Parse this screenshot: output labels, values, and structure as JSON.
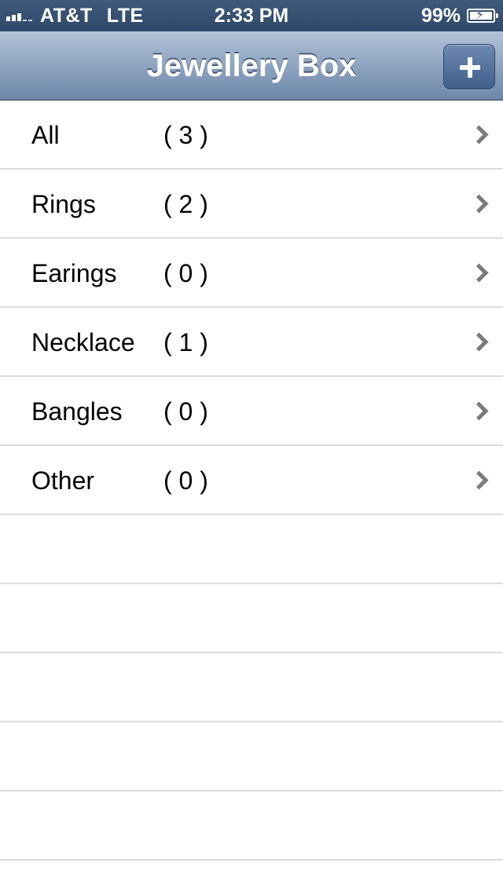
{
  "status_bar": {
    "carrier": "AT&T",
    "network": "LTE",
    "time": "2:33 PM",
    "battery_percent": "99%"
  },
  "nav": {
    "title": "Jewellery Box",
    "add_button_icon": "plus-icon"
  },
  "categories": [
    {
      "label": "All",
      "count": "( 3 )"
    },
    {
      "label": "Rings",
      "count": "( 2 )"
    },
    {
      "label": "Earings",
      "count": "( 0 )"
    },
    {
      "label": "Necklace",
      "count": "( 1 )"
    },
    {
      "label": "Bangles",
      "count": "( 0 )"
    },
    {
      "label": "Other",
      "count": "( 0 )"
    }
  ],
  "colors": {
    "status_bar": "#2e4868",
    "nav_bar_top": "#b3c3d8",
    "nav_bar_bottom": "#6d87a8",
    "separator": "#dcdcdc",
    "chevron": "#7a7a7a"
  }
}
